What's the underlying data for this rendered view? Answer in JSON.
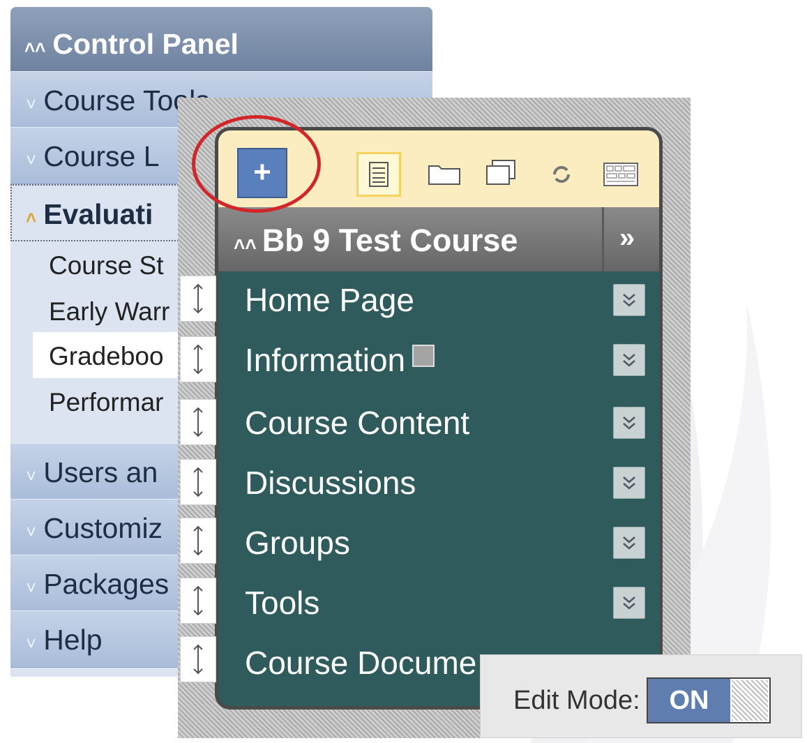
{
  "control_panel": {
    "title": "Control Panel",
    "sections": [
      {
        "label": "Course Tools"
      },
      {
        "label": "Course L"
      }
    ],
    "open_section": "Evaluati",
    "sub_items": [
      "Course St",
      "Early Warr",
      "Gradeboo",
      "Performar"
    ],
    "collapsed_sections": [
      "Users an",
      "Customiz",
      "Packages",
      "Help"
    ]
  },
  "course_menu": {
    "add_button": "+",
    "toolbar_icons": [
      "list-view-icon",
      "folder-view-icon",
      "window-icon",
      "refresh-icon",
      "grid-icon"
    ],
    "course_title": "Bb 9 Test Course",
    "expand_label": "»",
    "items": [
      {
        "label": "Home Page"
      },
      {
        "label": "Information"
      },
      {
        "label": "Course Content"
      },
      {
        "label": "Discussions"
      },
      {
        "label": "Groups"
      },
      {
        "label": "Tools"
      },
      {
        "label": "Course Docume"
      }
    ]
  },
  "edit_mode": {
    "label": "Edit Mode:",
    "state": "ON"
  }
}
